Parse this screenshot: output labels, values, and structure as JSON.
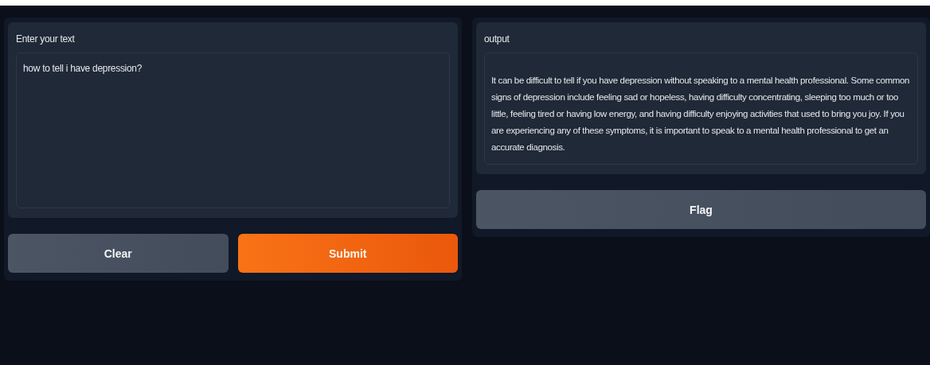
{
  "input_panel": {
    "label": "Enter your text",
    "value": "how to tell i have depression?"
  },
  "buttons": [
    {
      "label": "Clear",
      "kind": "secondary"
    },
    {
      "label": "Submit",
      "kind": "primary"
    }
  ],
  "output_panel": {
    "label": "output",
    "value": "It can be difficult to tell if you have depression without speaking to a mental health professional. Some common signs of depression include feeling sad or hopeless, having difficulty concentrating, sleeping too much or too little, feeling tired or having low energy, and having difficulty enjoying activities that used to bring you joy. If you are experiencing any of these symptoms, it is important to speak to a mental health professional to get an accurate diagnosis."
  },
  "flag_button": {
    "label": "Flag"
  }
}
